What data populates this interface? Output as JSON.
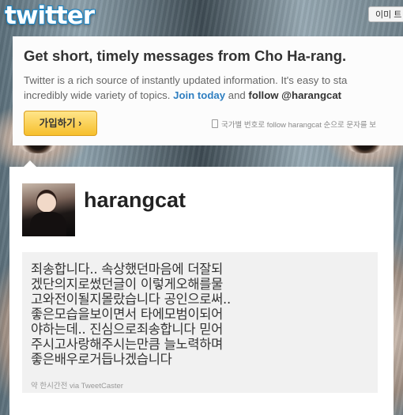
{
  "header": {
    "logo_text": "twitter",
    "button_label": "이미 트"
  },
  "promo": {
    "headline": "Get short, timely messages from Cho Ha-rang.",
    "line1": "Twitter is a rich source of instantly updated information. It's easy to sta",
    "line2_prefix": "incredibly wide variety of topics.",
    "join_link": "Join today",
    "line2_mid": "and",
    "follow_text": "follow @harangcat",
    "signup_button": "가입하기 ›",
    "sms_note": "국가별 번호로 follow harangcat 순으로 문자를 보"
  },
  "profile": {
    "username": "harangcat"
  },
  "tweet": {
    "text": "죄송합니다.. 속상했던마음에 더잘되\n겠단의지로썼던글이 이렇게오해를물\n고와전이될지몰랐습니다 공인으로써..\n좋은모습을보이면서 타에모범이되어\n야하는데.. 진심으로죄송합니다 믿어\n주시고사랑해주시는만큼 늘노력하며\n좋은배우로거듭나겠습니다",
    "time": "약 한시간전",
    "via_prefix": "via",
    "client": "TweetCaster"
  }
}
